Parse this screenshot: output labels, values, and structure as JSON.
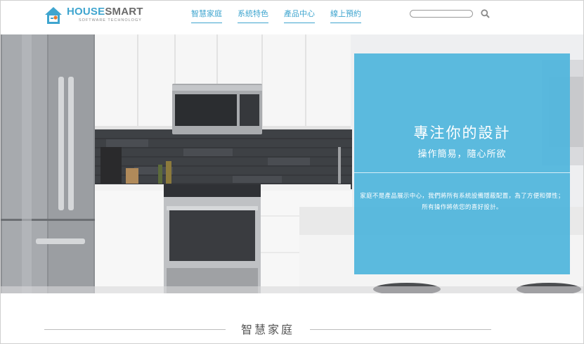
{
  "brand": {
    "name_part1": "HOUSE",
    "name_part2": "SMART",
    "tagline": "SOFTWARE TECHNOLOGY",
    "accent_color": "#3fa5cf"
  },
  "nav": {
    "items": [
      {
        "label": "智慧家庭"
      },
      {
        "label": "系統特色"
      },
      {
        "label": "產品中心"
      },
      {
        "label": "線上預約"
      }
    ]
  },
  "search": {
    "placeholder": "",
    "icon": "search-icon"
  },
  "hero": {
    "image": "modern-kitchen-photo",
    "overlay_color": "#52b6dc",
    "title": "專注你的設計",
    "subtitle": "操作簡易，隨心所欲",
    "description": "家庭不是產品展示中心，我們將所有系統設備隱蔽配置，為了方便和彈性；所有操作將依您的喜好設計。"
  },
  "section": {
    "title": "智慧家庭"
  }
}
